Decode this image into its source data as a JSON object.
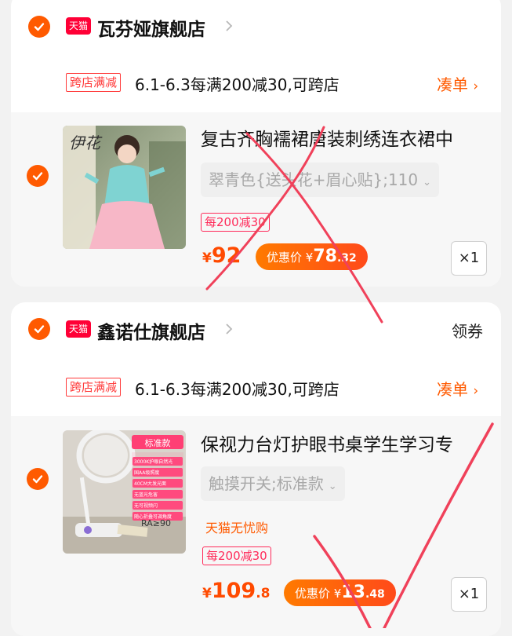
{
  "stores": [
    {
      "badge": "天猫",
      "name": "瓦芬娅旗舰店",
      "coupon": "",
      "promo": {
        "tag": "跨店满减",
        "text": "6.1-6.3每满200减30,可跨店",
        "link": "凑单"
      },
      "item": {
        "title": "复古齐胸襦裙唐装刺绣连衣裙中",
        "sku": "翠青色{送头花+眉心贴};110",
        "tag": "",
        "discount": "每200减30",
        "price": {
          "currency": "¥",
          "int": "92",
          "dec": ""
        },
        "deal": {
          "label": "优惠价",
          "currency": "¥",
          "int": "78",
          "dec": ".32"
        },
        "qty": "×1",
        "thumb_text": "伊花"
      }
    },
    {
      "badge": "天猫",
      "name": "鑫诺仕旗舰店",
      "coupon": "领券",
      "promo": {
        "tag": "跨店满减",
        "text": "6.1-6.3每满200减30,可跨店",
        "link": "凑单"
      },
      "item": {
        "title": "保视力台灯护眼书桌学生学习专",
        "sku": "触摸开关;标准款",
        "tag": "天猫无忧购",
        "discount": "每200减30",
        "price": {
          "currency": "¥",
          "int": "109",
          "dec": ".8"
        },
        "deal": {
          "label": "优惠价",
          "currency": "¥",
          "int": "13",
          "dec": ".48"
        },
        "qty": "×1",
        "thumb_label": "标准款",
        "thumb_features": [
          "3000K护眼自然光",
          "国AA级照度",
          "40CM大发光面",
          "无蓝光危害",
          "无可视频闪",
          "随心折叠可调角度"
        ],
        "thumb_ra": "RA≥90"
      }
    }
  ],
  "colors": {
    "accent": "#ff5a00",
    "tmall_red": "#ff0036",
    "promo_red": "#ff3a3a",
    "annotation": "#f0415a"
  }
}
